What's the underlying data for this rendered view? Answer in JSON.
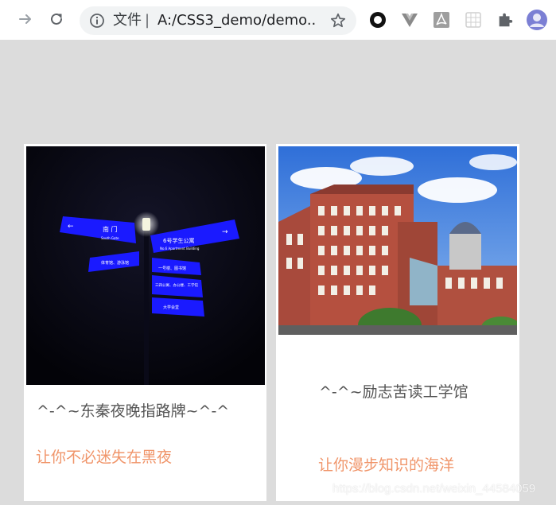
{
  "browser": {
    "omnibox": {
      "security_label": "文件",
      "separator": "|",
      "url": "A:/CSS3_demo/demo..."
    },
    "icons": {
      "back": "arrow-right-icon",
      "reload": "reload-icon",
      "info": "info-icon",
      "star": "star-icon",
      "extensions": [
        "circle-extension-icon",
        "vue-devtools-icon",
        "pdf-icon",
        "grid-extension-icon",
        "puzzle-icon",
        "profile-avatar-icon"
      ]
    }
  },
  "cards": [
    {
      "title": "^-^~东秦夜晚指路牌~^-^",
      "subtitle": "让你不必迷失在黑夜",
      "photo": {
        "sign_left_main": "南 门",
        "sign_left_sub": "South Gate",
        "sign_right_main": "6号学生公寓",
        "sign_right_sub": "No.6 Apartment Building",
        "sign_r2": "一号楼、图书馆",
        "sign_r3": "三四公寓、办公楼、工学馆",
        "sign_r4": "大学会堂",
        "sign_l2": "体育馆、游泳馆"
      }
    },
    {
      "title": "^-^~励志苦读工学馆",
      "subtitle": "让你漫步知识的海洋"
    }
  ],
  "watermark": "https://blog.csdn.net/weixin_44584059",
  "colors": {
    "page_bg": "#dcdcdc",
    "title_text": "#555555",
    "subtitle_text": "#f0956a",
    "sign_blue": "#1a1aff"
  }
}
